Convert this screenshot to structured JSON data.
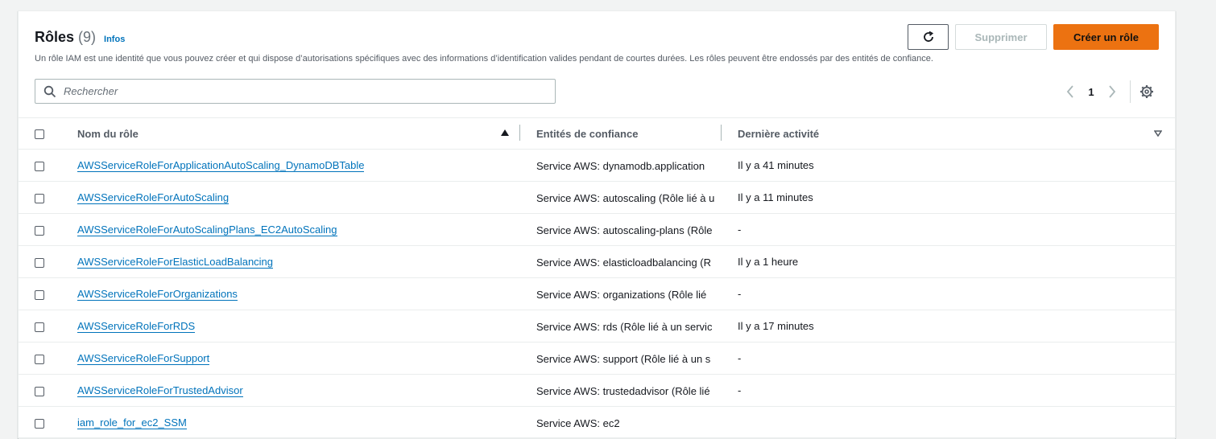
{
  "header": {
    "title": "Rôles",
    "count": "(9)",
    "info_link": "Infos",
    "description": "Un rôle IAM est une identité que vous pouvez créer et qui dispose d’autorisations spécifiques avec des informations d’identification valides pendant de courtes durées. Les rôles peuvent être endossés par des entités de confiance.",
    "refresh_icon": "refresh-icon",
    "delete_label": "Supprimer",
    "create_label": "Créer un rôle"
  },
  "search": {
    "placeholder": "Rechercher",
    "icon": "search-icon"
  },
  "pagination": {
    "current_page": "1",
    "prev_icon": "chevron-left-icon",
    "next_icon": "chevron-right-icon",
    "settings_icon": "gear-icon"
  },
  "table": {
    "columns": {
      "name": "Nom du rôle",
      "trust": "Entités de confiance",
      "activity": "Dernière activité"
    },
    "rows": [
      {
        "name": "AWSServiceRoleForApplicationAutoScaling_DynamoDBTable",
        "trust_prefix": "Service AWS: dynamodb.application",
        "trust_link": "",
        "activity": "Il y a 41 minutes"
      },
      {
        "name": "AWSServiceRoleForAutoScaling",
        "trust_prefix": "Service AWS: autoscaling ",
        "trust_link": "(Rôle lié à u",
        "activity": "Il y a 11 minutes"
      },
      {
        "name": "AWSServiceRoleForAutoScalingPlans_EC2AutoScaling",
        "trust_prefix": "Service AWS: autoscaling-plans ",
        "trust_link": "(Rôle",
        "activity": "-"
      },
      {
        "name": "AWSServiceRoleForElasticLoadBalancing",
        "trust_prefix": "Service AWS: elasticloadbalancing ",
        "trust_link": "(R",
        "activity": "Il y a 1 heure"
      },
      {
        "name": "AWSServiceRoleForOrganizations",
        "trust_prefix": "Service AWS: organizations ",
        "trust_link": "(Rôle lié",
        "activity": "-"
      },
      {
        "name": "AWSServiceRoleForRDS",
        "trust_prefix": "Service AWS: rds ",
        "trust_link": "(Rôle lié à un servic",
        "activity": "Il y a 17 minutes"
      },
      {
        "name": "AWSServiceRoleForSupport",
        "trust_prefix": "Service AWS: support ",
        "trust_link": "(Rôle lié à un s",
        "activity": "-"
      },
      {
        "name": "AWSServiceRoleForTrustedAdvisor",
        "trust_prefix": "Service AWS: trustedadvisor ",
        "trust_link": "(Rôle lié",
        "activity": "-"
      },
      {
        "name": "iam_role_for_ec2_SSM",
        "trust_prefix": "Service AWS: ec2",
        "trust_link": "",
        "activity": ""
      }
    ]
  },
  "colors": {
    "primary": "#ec7211",
    "link": "#0073bb",
    "border": "#eaeded"
  }
}
